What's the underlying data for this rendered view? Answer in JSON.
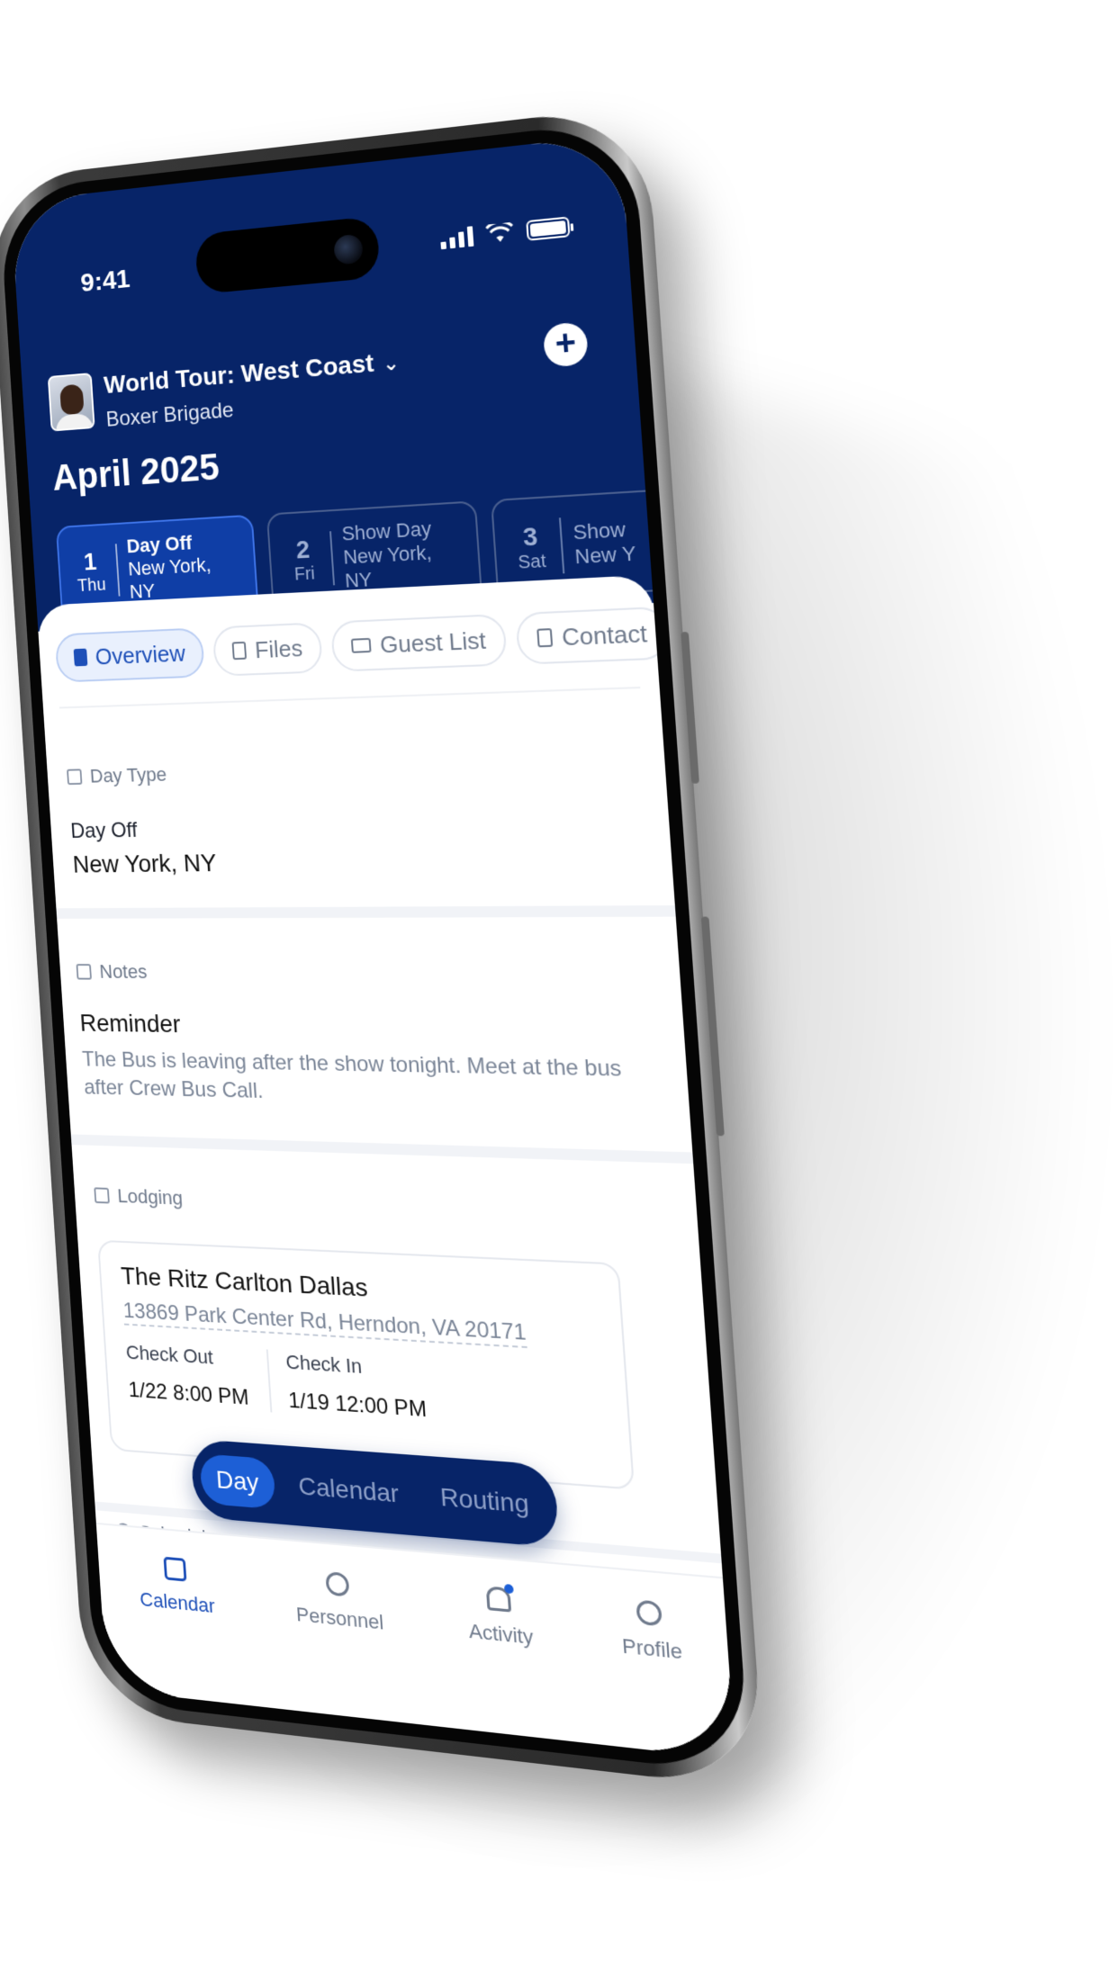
{
  "status": {
    "time": "9:41"
  },
  "header": {
    "tour_title": "World Tour: West Coast",
    "artist": "Boxer Brigade",
    "month": "April 2025"
  },
  "days": [
    {
      "num": "1",
      "weekday": "Thu",
      "type": "Day Off",
      "city": "New York, NY"
    },
    {
      "num": "2",
      "weekday": "Fri",
      "type": "Show Day",
      "city": "New York, NY"
    },
    {
      "num": "3",
      "weekday": "Sat",
      "type": "Show",
      "city": "New Y"
    }
  ],
  "tabs": [
    {
      "label": "Overview"
    },
    {
      "label": "Files"
    },
    {
      "label": "Guest List"
    },
    {
      "label": "Contact"
    }
  ],
  "day_type": {
    "label": "Day Type",
    "type": "Day Off",
    "city": "New York, NY"
  },
  "notes": {
    "label": "Notes",
    "title": "Reminder",
    "body": "The Bus is leaving after the show tonight. Meet at the bus after Crew Bus Call."
  },
  "lodging": {
    "label": "Lodging",
    "hotel": "The Ritz Carlton Dallas",
    "address": "13869 Park Center Rd, Herndon, VA 20171",
    "check_out_label": "Check Out",
    "check_out": "1/22 8:00 PM",
    "check_in_label": "Check In",
    "check_in": "1/19 12:00 PM"
  },
  "segmented": {
    "day": "Day",
    "calendar": "Calendar",
    "routing": "Routing"
  },
  "schedule_label": "Schedule",
  "tab_bar": [
    {
      "label": "Calendar",
      "icon": "calendar-icon"
    },
    {
      "label": "Personnel",
      "icon": "people-icon"
    },
    {
      "label": "Activity",
      "icon": "bell-icon"
    },
    {
      "label": "Profile",
      "icon": "person-icon"
    }
  ],
  "colors": {
    "navy": "#072468",
    "accent": "#1d5fd6"
  }
}
